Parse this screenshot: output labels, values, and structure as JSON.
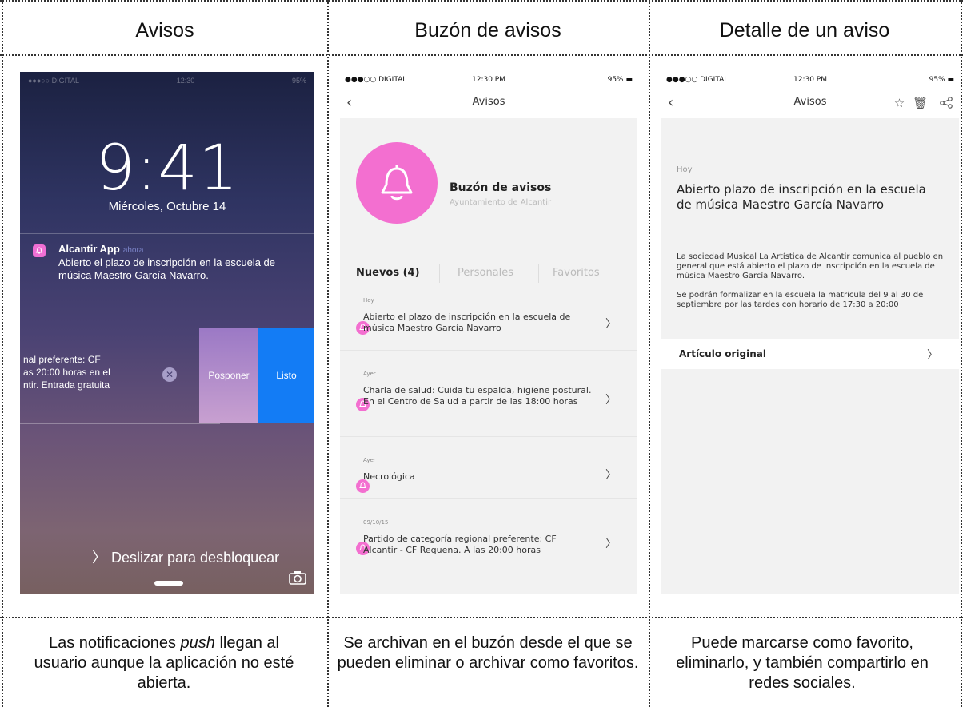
{
  "columns": [
    {
      "title": "Avisos",
      "caption_pre": "Las notificaciones ",
      "caption_em": "push",
      "caption_post": " llegan al usuario aunque la aplicación no esté abierta."
    },
    {
      "title": "Buzón de avisos",
      "caption": "Se archivan en el buzón desde el que se pueden eliminar o archivar como favoritos."
    },
    {
      "title": "Detalle de un aviso",
      "caption": "Puede marcarse como favorito, eliminarlo, y también compartirlo en redes sociales."
    }
  ],
  "lock": {
    "time": "9:41",
    "date": "Miércoles, Octubre 14",
    "notification": {
      "app": "Alcantir App",
      "time": "ahora",
      "body": "Abierto el plazo de inscripción en la escuela de música Maestro García Navarro."
    },
    "swiped_text": "nal preferente: CF\nas 20:00 horas en el\nntir. Entrada gratuita",
    "later_label": "Posponer",
    "done_label": "Listo",
    "unlock_label": "Deslizar para desbloquear"
  },
  "status_bar": {
    "carrier": "●●●○○ DIGITAL",
    "time": "12:30 PM",
    "battery": "95%"
  },
  "inbox": {
    "nav_title": "Avisos",
    "box_title": "Buzón de avisos",
    "box_subtitle": "Ayuntamiento de Alcantir",
    "tabs": [
      "Nuevos (4)",
      "Personales",
      "Favoritos"
    ],
    "items": [
      {
        "date": "Hoy",
        "text": "Abierto el plazo de inscripción en la escuela de música Maestro García Navarro"
      },
      {
        "date": "Ayer",
        "text": "Charla de salud: Cuida tu espalda, higiene postural. En el Centro de Salud a partir de las 18:00 horas"
      },
      {
        "date": "Ayer",
        "text": "Necrológica"
      },
      {
        "date": "09/10/15",
        "text": "Partido de categoría regional preferente: CF Alcantir - CF Requena. A las 20:00 horas"
      }
    ]
  },
  "detail": {
    "nav_title": "Avisos",
    "day": "Hoy",
    "title": "Abierto plazo de inscripción en la escuela de música Maestro García Navarro",
    "p1": "La sociedad Musical La Artística de Alcantir comunica al pueblo en general que está abierto el plazo de inscripción en la escuela de música Maestro García Navarro.",
    "p2": "Se podrán formalizar en la escuela la matrícula del 9 al 30 de septiembre por las tardes con horario de 17:30 a 20:00",
    "original_link": "Artículo original"
  },
  "colors": {
    "accent": "#f36fd0",
    "ios_blue": "#137cf5"
  }
}
